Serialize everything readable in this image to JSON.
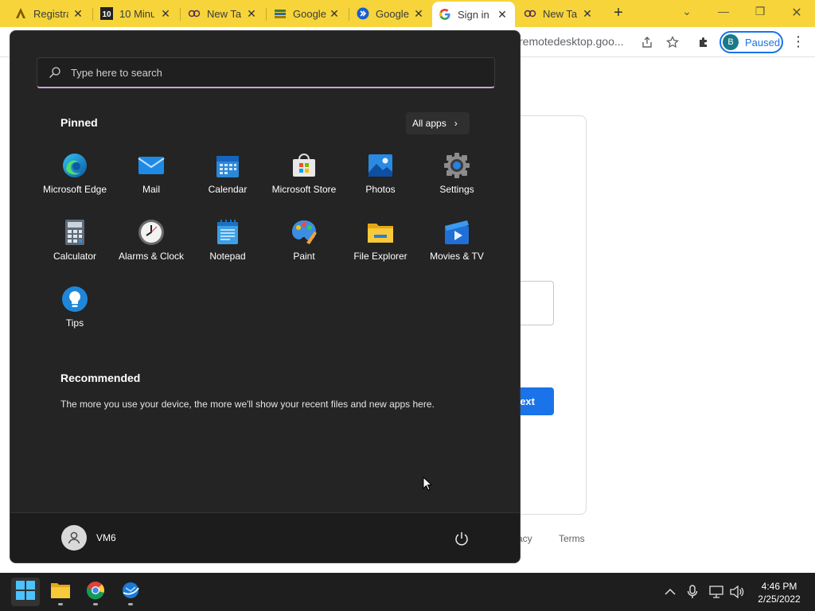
{
  "tabs": [
    {
      "title": "Registra",
      "icon": "acrobat-icon"
    },
    {
      "title": "10 Minu",
      "icon": "10-icon"
    },
    {
      "title": "New Tab",
      "icon": "extension-face-icon"
    },
    {
      "title": "Google",
      "icon": "google-drive-icon"
    },
    {
      "title": "Google",
      "icon": "remote-desktop-icon"
    },
    {
      "title": "Sign in",
      "icon": "google-g-icon",
      "active": true
    },
    {
      "title": "New Tab",
      "icon": "extension-face-icon"
    }
  ],
  "toolbar": {
    "url_fragment": "remotedesktop.goo...",
    "profile_initial": "B",
    "profile_status": "Paused"
  },
  "background_page": {
    "next_label": "ext",
    "privacy_label": "acy",
    "terms_label": "Terms"
  },
  "start_menu": {
    "search_placeholder": "Type here to search",
    "pinned_title": "Pinned",
    "all_apps_label": "All apps",
    "pinned": [
      {
        "label": "Microsoft Edge",
        "icon": "edge-icon"
      },
      {
        "label": "Mail",
        "icon": "mail-icon"
      },
      {
        "label": "Calendar",
        "icon": "calendar-icon"
      },
      {
        "label": "Microsoft Store",
        "icon": "store-icon"
      },
      {
        "label": "Photos",
        "icon": "photos-icon"
      },
      {
        "label": "Settings",
        "icon": "settings-gear-icon"
      },
      {
        "label": "Calculator",
        "icon": "calculator-icon"
      },
      {
        "label": "Alarms & Clock",
        "icon": "clock-icon"
      },
      {
        "label": "Notepad",
        "icon": "notepad-icon"
      },
      {
        "label": "Paint",
        "icon": "paint-palette-icon"
      },
      {
        "label": "File Explorer",
        "icon": "folder-icon"
      },
      {
        "label": "Movies & TV",
        "icon": "movies-icon"
      },
      {
        "label": "Tips",
        "icon": "lightbulb-icon"
      }
    ],
    "recommended_title": "Recommended",
    "recommended_text": "The more you use your device, the more we'll show your recent files and new apps here.",
    "user_name": "VM6"
  },
  "taskbar": {
    "time": "4:46 PM",
    "date": "2/25/2022"
  },
  "colors": {
    "tabbar": "#f6d43a",
    "start_bg": "#242424",
    "accent_blue": "#1a73e8",
    "search_underline": "#c9a3d3"
  }
}
